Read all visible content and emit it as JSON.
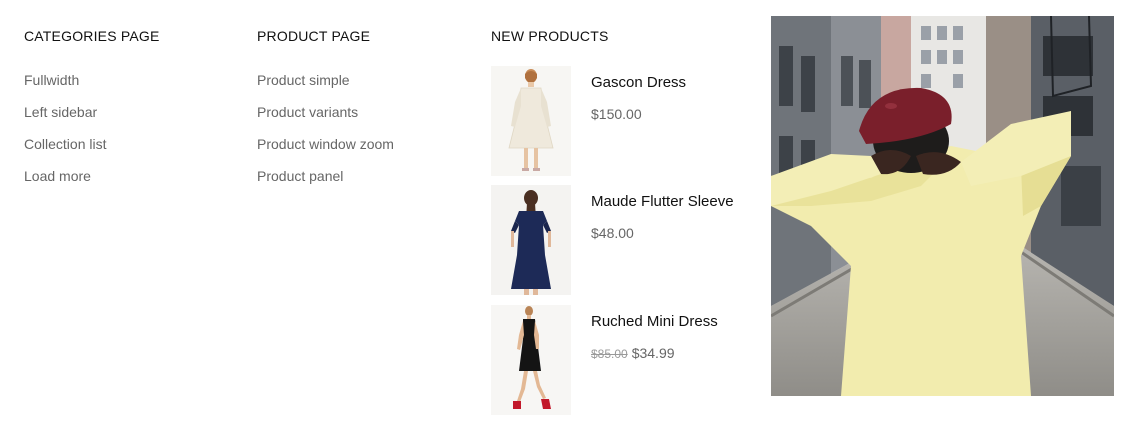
{
  "categories": {
    "title": "CATEGORIES PAGE",
    "items": [
      "Fullwidth",
      "Left sidebar",
      "Collection list",
      "Load more"
    ]
  },
  "product_page": {
    "title": "PRODUCT PAGE",
    "items": [
      "Product simple",
      "Product variants",
      "Product window zoom",
      "Product panel"
    ]
  },
  "new_products": {
    "title": "NEW PRODUCTS",
    "items": [
      {
        "name": "Gascon Dress",
        "price": "$150.00",
        "old_price": ""
      },
      {
        "name": "Maude Flutter Sleeve",
        "price": "$48.00",
        "old_price": ""
      },
      {
        "name": "Ruched Mini Dress",
        "price": "$34.99",
        "old_price": "$85.00"
      }
    ]
  },
  "colors": {
    "heading": "#111111",
    "link": "#666666",
    "old_price": "#999999",
    "sweater": "#f2ecae",
    "beret": "#7a1f2b"
  },
  "icons": {
    "product_1": "white-dress-thumbnail",
    "product_2": "navy-dress-thumbnail",
    "product_3": "black-dress-thumbnail",
    "banner": "yellow-sweater-street-photo"
  }
}
